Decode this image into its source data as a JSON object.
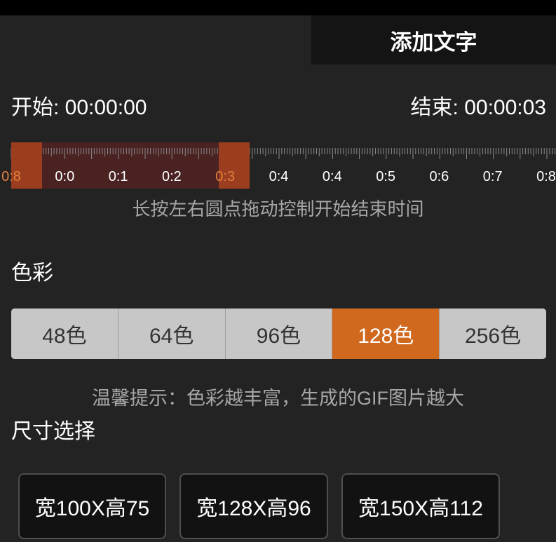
{
  "header": {
    "add_text_label": "添加文字"
  },
  "time": {
    "start": "开始: 00:00:00",
    "end": "结束: 00:00:03"
  },
  "timeline": {
    "tick_labels": [
      "0:8",
      "0:0",
      "0:1",
      "0:2",
      "0:3",
      "0:4",
      "0:4",
      "0:5",
      "0:6",
      "0:7",
      "0:8"
    ],
    "highlighted_tick_indices": [
      0,
      4
    ],
    "hint": "长按左右圆点拖动控制开始结束时间"
  },
  "color": {
    "label": "色彩",
    "options": [
      "48色",
      "64色",
      "96色",
      "128色",
      "256色"
    ],
    "selected": "128色",
    "hint": "温馨提示：色彩越丰富，生成的GIF图片越大",
    "accent": "#d0691e"
  },
  "size": {
    "label": "尺寸选择",
    "options": [
      "宽100X高75",
      "宽128X高96",
      "宽150X高112"
    ]
  }
}
